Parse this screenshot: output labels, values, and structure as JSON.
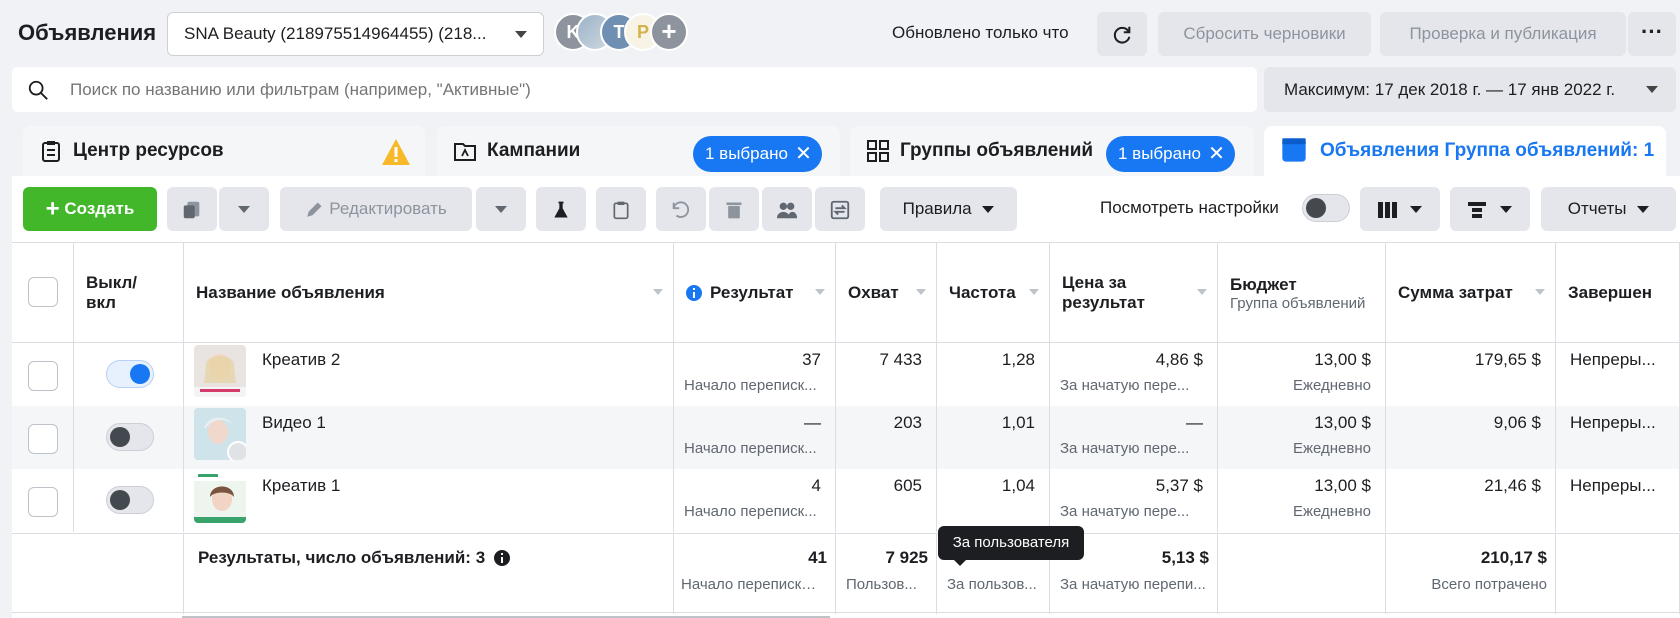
{
  "header": {
    "title": "Объявления",
    "account": "SNA Beauty (218975514964455) (218...",
    "avatars": [
      "K",
      "",
      "T",
      "P",
      "+"
    ],
    "updated": "Обновлено только что",
    "reset_drafts": "Сбросить черновики",
    "review_publish": "Проверка и публикация",
    "more": "···"
  },
  "search": {
    "placeholder": "Поиск по названию или фильтрам (например, \"Активные\")"
  },
  "daterange": "Максимум: 17 дек 2018 г. — 17 янв 2022 г.",
  "tabs": {
    "resources": "Центр ресурсов",
    "campaigns": "Кампании",
    "campaigns_chip": "1 выбрано",
    "adsets": "Группы объявлений",
    "adsets_chip": "1 выбрано",
    "ads": "Объявления Группа объявлений: 1"
  },
  "toolbar": {
    "create": "Создать",
    "edit": "Редактировать",
    "rules": "Правила",
    "view_settings": "Посмотреть настройки",
    "reports": "Отчеты"
  },
  "columns": {
    "onoff": "Выкл/ вкл",
    "name": "Название объявления",
    "result": "Результат",
    "reach": "Охват",
    "frequency": "Частота",
    "cost": "Цена за результат",
    "budget": "Бюджет",
    "budget_sub": "Группа объявлений",
    "spent": "Сумма затрат",
    "ends": "Завершен"
  },
  "rows": [
    {
      "name": "Креатив 2",
      "on": true,
      "result": "37",
      "result_sub": "Начало переписк...",
      "reach": "7 433",
      "freq": "1,28",
      "cost": "4,86 $",
      "cost_sub": "За начатую пере...",
      "budget": "13,00 $",
      "budget_sub": "Ежедневно",
      "spent": "179,65 $",
      "ends": "Непреры..."
    },
    {
      "name": "Видео 1",
      "on": false,
      "result": "—",
      "result_sub": "Начало переписк...",
      "reach": "203",
      "freq": "1,01",
      "cost": "—",
      "cost_sub": "За начатую пере...",
      "budget": "13,00 $",
      "budget_sub": "Ежедневно",
      "spent": "9,06 $",
      "ends": "Непреры..."
    },
    {
      "name": "Креатив 1",
      "on": false,
      "result": "4",
      "result_sub": "Начало переписк...",
      "reach": "605",
      "freq": "1,04",
      "cost": "5,37 $",
      "cost_sub": "За начатую пере...",
      "budget": "13,00 $",
      "budget_sub": "Ежедневно",
      "spent": "21,46 $",
      "ends": "Непреры..."
    }
  ],
  "totals": {
    "label": "Результаты, число объявлений: 3",
    "result": "41",
    "result_sub": "Начало переписки ...",
    "reach": "7 925",
    "reach_sub": "Пользов...",
    "freq_sub": "За пользов...",
    "cost": "5,13 $",
    "cost_sub": "За начатую перепи...",
    "spent": "210,17 $",
    "spent_sub": "Всего потрачено"
  },
  "tooltip": "За пользователя",
  "colors": {
    "accent": "#1877f2",
    "create": "#42b72a",
    "warning": "#f7b928"
  }
}
